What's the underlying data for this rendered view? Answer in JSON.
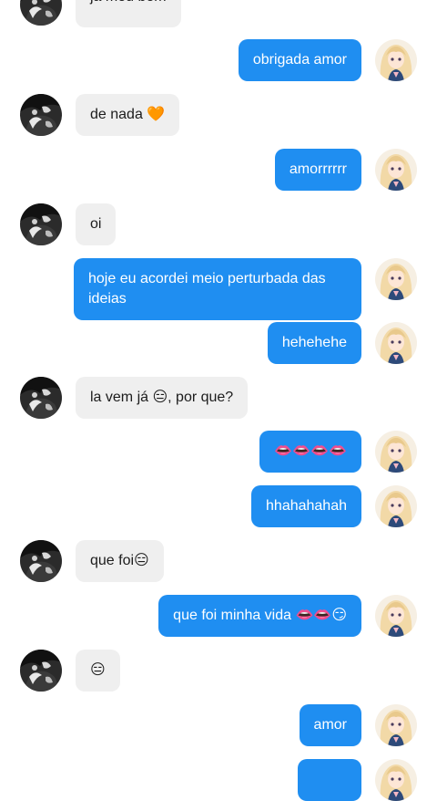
{
  "messages": [
    {
      "side": "in",
      "text": "já meu bem"
    },
    {
      "side": "out",
      "text": "obrigada amor"
    },
    {
      "side": "in",
      "text": "de nada 🧡"
    },
    {
      "side": "out",
      "text": "amorrrrrr"
    },
    {
      "side": "in",
      "text": "oi"
    },
    {
      "side": "out",
      "text": "hoje eu acordei meio perturbada das ideias"
    },
    {
      "side": "out",
      "text": "hehehehe"
    },
    {
      "side": "in",
      "text": "la vem já 😑, por que?"
    },
    {
      "side": "out",
      "text": "👄👄👄👄"
    },
    {
      "side": "out",
      "text": "hhahahahah"
    },
    {
      "side": "in",
      "text": "que foi😑"
    },
    {
      "side": "out",
      "text": "que foi minha vida 👄👄😏"
    },
    {
      "side": "in",
      "text": "😑"
    },
    {
      "side": "out",
      "text": "amor"
    },
    {
      "side": "out",
      "text": ""
    }
  ],
  "avatars": {
    "incoming": "dark-anime-avatar",
    "outgoing": "blonde-anime-avatar"
  },
  "colors": {
    "outgoing_bubble": "#1f8ef1",
    "incoming_bubble": "#efefef",
    "background": "#ffffff"
  }
}
